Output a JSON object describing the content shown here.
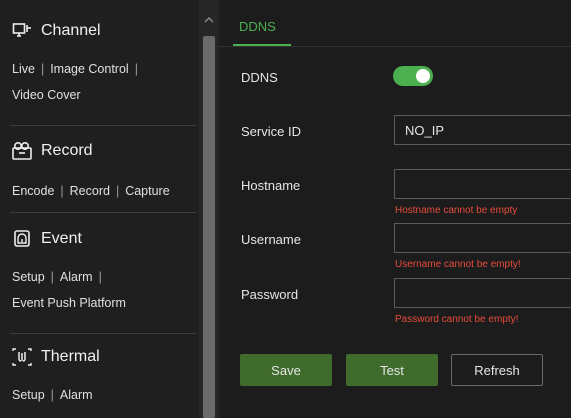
{
  "sidebar": {
    "channel": {
      "title": "Channel",
      "icon": "monitor-icon",
      "links": [
        "Live",
        "Image Control",
        "Video Cover"
      ]
    },
    "record": {
      "title": "Record",
      "icon": "record-icon",
      "links": [
        "Encode",
        "Record",
        "Capture"
      ]
    },
    "event": {
      "title": "Event",
      "icon": "alarm-bell-icon",
      "links": [
        "Setup",
        "Alarm",
        "Event Push Platform"
      ]
    },
    "thermal": {
      "title": "Thermal",
      "icon": "thermal-icon",
      "links": [
        "Setup",
        "Alarm"
      ]
    }
  },
  "tab": {
    "label": "DDNS"
  },
  "form": {
    "ddns_label": "DDNS",
    "ddns_enabled": true,
    "service_label": "Service ID",
    "service_value": "NO_IP",
    "hostname_label": "Hostname",
    "hostname_value": "",
    "hostname_error": "Hostname cannot be empty",
    "username_label": "Username",
    "username_value": "",
    "username_error": "Username cannot be empty!",
    "password_label": "Password",
    "password_value": "",
    "password_error": "Password cannot be empty!"
  },
  "buttons": {
    "save": "Save",
    "test": "Test",
    "refresh": "Refresh"
  },
  "colors": {
    "accent": "#4caf50",
    "error": "#e74c3c",
    "button_green": "#3f6b2c"
  }
}
